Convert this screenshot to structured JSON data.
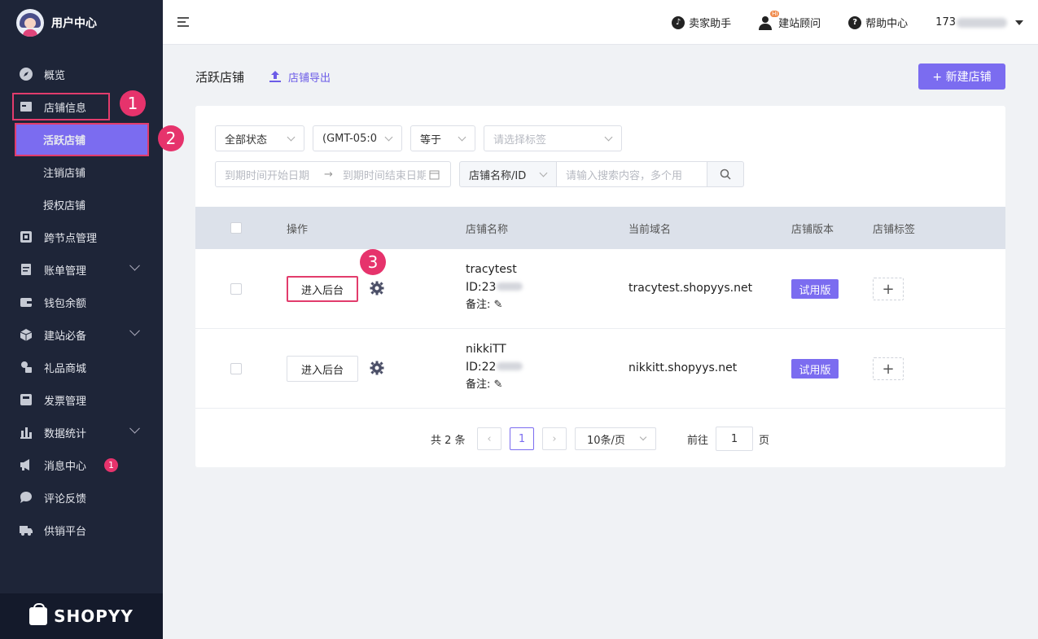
{
  "sidebar": {
    "title": "用户中心",
    "items": [
      {
        "label": "概览"
      },
      {
        "label": "店铺信息"
      },
      {
        "label": "活跃店铺"
      },
      {
        "label": "注销店铺"
      },
      {
        "label": "授权店铺"
      },
      {
        "label": "跨节点管理"
      },
      {
        "label": "账单管理"
      },
      {
        "label": "钱包余额"
      },
      {
        "label": "建站必备"
      },
      {
        "label": "礼品商城"
      },
      {
        "label": "发票管理"
      },
      {
        "label": "数据统计"
      },
      {
        "label": "消息中心",
        "badge": "1"
      },
      {
        "label": "评论反馈"
      },
      {
        "label": "供销平台"
      }
    ],
    "brand": "SHOPYY"
  },
  "callouts": [
    "1",
    "2",
    "3"
  ],
  "topbar": {
    "seller_helper": "卖家助手",
    "consultant": "建站顾问",
    "consultant_badge": "Hi",
    "help": "帮助中心",
    "account": "173"
  },
  "page": {
    "title": "活跃店铺",
    "export": "店铺导出",
    "new_store": "+ 新建店铺"
  },
  "filters": {
    "status": "全部状态",
    "timezone": "(GMT-05:0",
    "operator": "等于",
    "tag_placeholder": "请选择标签",
    "date_start_placeholder": "到期时间开始日期",
    "date_end_placeholder": "到期时间结束日期",
    "search_field": "店铺名称/ID",
    "search_placeholder": "请输入搜索内容，多个用"
  },
  "table": {
    "headers": [
      "操作",
      "店铺名称",
      "当前域名",
      "店铺版本",
      "店铺标签"
    ],
    "enter_label": "进入后台",
    "note_label": "备注:",
    "rows": [
      {
        "name": "tracytest",
        "id": "ID:23",
        "domain": "tracytest.shopyys.net",
        "version": "试用版"
      },
      {
        "name": "nikkiTT",
        "id": "ID:22",
        "domain": "nikkitt.shopyys.net",
        "version": "试用版"
      }
    ]
  },
  "pagination": {
    "total": "共 2 条",
    "current_page": "1",
    "page_size": "10条/页",
    "goto_label": "前往",
    "goto_value": "1",
    "page_suffix": "页"
  }
}
